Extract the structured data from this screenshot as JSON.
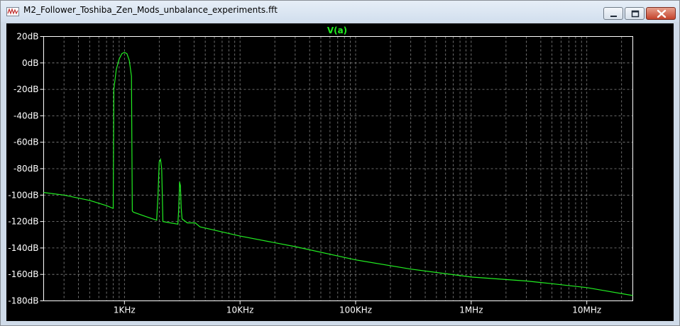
{
  "window": {
    "title": "M2_Follower_Toshiba_Zen_Mods_unbalance_experiments.fft",
    "controls": {
      "minimize": "minimize",
      "maximize": "maximize",
      "close": "close"
    }
  },
  "colors": {
    "background": "#000000",
    "trace": "#22ee22",
    "grid": "#8a8a8a",
    "text": "#ffffff"
  },
  "chart_data": {
    "type": "line",
    "title": "V(a)",
    "xlabel": "",
    "ylabel": "",
    "x_scale": "log",
    "xlim": [
      200,
      25000000
    ],
    "ylim": [
      -180,
      20
    ],
    "grid": true,
    "x_ticks": [
      {
        "value": 1000,
        "label": "1KHz"
      },
      {
        "value": 10000,
        "label": "10KHz"
      },
      {
        "value": 100000,
        "label": "100KHz"
      },
      {
        "value": 1000000,
        "label": "1MHz"
      },
      {
        "value": 10000000,
        "label": "10MHz"
      }
    ],
    "y_ticks": [
      {
        "value": 20,
        "label": "20dB"
      },
      {
        "value": 0,
        "label": "0dB"
      },
      {
        "value": -20,
        "label": "-20dB"
      },
      {
        "value": -40,
        "label": "-40dB"
      },
      {
        "value": -60,
        "label": "-60dB"
      },
      {
        "value": -80,
        "label": "-80dB"
      },
      {
        "value": -100,
        "label": "-100dB"
      },
      {
        "value": -120,
        "label": "-120dB"
      },
      {
        "value": -140,
        "label": "-140dB"
      },
      {
        "value": -160,
        "label": "-160dB"
      },
      {
        "value": -180,
        "label": "-180dB"
      }
    ],
    "series": [
      {
        "name": "V(a)",
        "x": [
          200,
          300,
          500,
          700,
          800,
          810,
          850,
          900,
          950,
          1000,
          1050,
          1100,
          1150,
          1170,
          1200,
          1500,
          1900,
          1950,
          2000,
          2050,
          2100,
          2150,
          2500,
          2900,
          2950,
          3000,
          3050,
          3100,
          3150,
          3500,
          4000,
          4100,
          4500,
          10000,
          30000,
          100000,
          300000,
          1000000,
          3000000,
          5000000,
          10000000,
          25000000
        ],
        "y": [
          -98,
          -100,
          -104,
          -108,
          -110,
          -20,
          -5,
          3,
          7,
          8,
          7,
          2,
          -10,
          -112,
          -113,
          -116,
          -119,
          -100,
          -75,
          -73,
          -80,
          -120,
          -121,
          -122,
          -110,
          -90,
          -93,
          -110,
          -118,
          -121,
          -121,
          -121,
          -124,
          -131,
          -139,
          -149,
          -156,
          -162,
          -165,
          -167,
          -170,
          -176
        ]
      }
    ]
  }
}
